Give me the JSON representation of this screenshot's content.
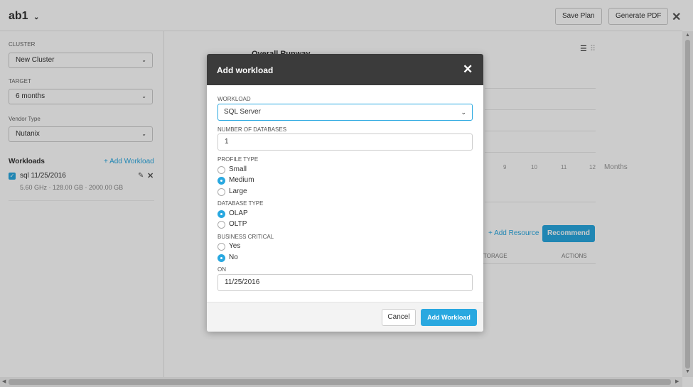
{
  "header": {
    "plan_title": "ab1",
    "chevron_glyph": "⌄",
    "save_plan": "Save Plan",
    "generate_pdf": "Generate PDF",
    "close_glyph": "✕"
  },
  "sidebar": {
    "cluster_label": "CLUSTER",
    "cluster_value": "New Cluster",
    "target_label": "TARGET",
    "target_value": "6 months",
    "vendor_label": "Vendor Type",
    "vendor_value": "Nutanix",
    "dropdown_glyph": "⌄",
    "workloads_heading": "Workloads",
    "add_workload_link": "+ Add Workload",
    "workloads": [
      {
        "checked": true,
        "name": "sql 11/25/2016",
        "specs": "5.60 GHz · 128.00 GB · 2000.00 GB"
      }
    ]
  },
  "main": {
    "chart_title": "Overall Runway",
    "month_ticks": [
      "9",
      "10",
      "11",
      "12"
    ],
    "months_label": "Months",
    "add_resource": "+ Add Resource",
    "recommend": "Recommend",
    "col_storage": "TORAGE",
    "col_actions": "ACTIONS"
  },
  "modal": {
    "title": "Add workload",
    "close_glyph": "✕",
    "workload_label": "WORKLOAD",
    "workload_value": "SQL Server",
    "dropdown_glyph": "⌄",
    "num_db_label": "NUMBER OF DATABASES",
    "num_db_value": "1",
    "profile_label": "PROFILE TYPE",
    "profile_options": [
      {
        "label": "Small",
        "selected": false
      },
      {
        "label": "Medium",
        "selected": true
      },
      {
        "label": "Large",
        "selected": false
      }
    ],
    "db_type_label": "DATABASE TYPE",
    "db_type_options": [
      {
        "label": "OLAP",
        "selected": true
      },
      {
        "label": "OLTP",
        "selected": false
      }
    ],
    "critical_label": "BUSINESS CRITICAL",
    "critical_options": [
      {
        "label": "Yes",
        "selected": false
      },
      {
        "label": "No",
        "selected": true
      }
    ],
    "on_label": "ON",
    "on_value": "11/25/2016",
    "cancel": "Cancel",
    "add_workload": "Add Workload"
  },
  "colors": {
    "accent": "#29a8e0",
    "modal_header": "#3b3b3b"
  }
}
